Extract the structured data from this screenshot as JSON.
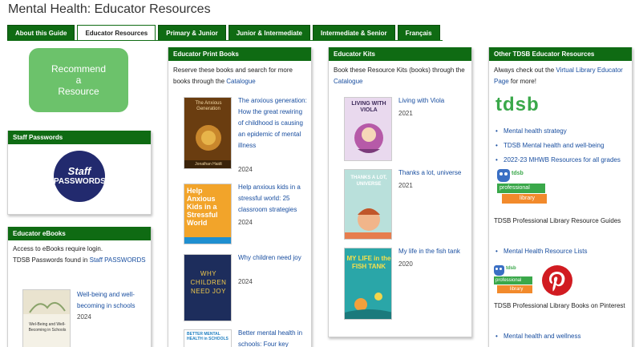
{
  "page_title": "Mental Health: Educator Resources",
  "tabs": [
    {
      "label": "About this Guide"
    },
    {
      "label": "Educator Resources"
    },
    {
      "label": "Primary & Junior"
    },
    {
      "label": "Junior & Intermediate"
    },
    {
      "label": "Intermediate & Senior"
    },
    {
      "label": "Français"
    }
  ],
  "recommend": {
    "line1": "Recommend",
    "line2": "a",
    "line3": "Resource"
  },
  "staff_passwords": {
    "title": "Staff Passwords",
    "logo_line1": "Staff",
    "logo_line2": "PASSWORDS"
  },
  "ebooks": {
    "title": "Educator eBooks",
    "text1": "Access to eBooks require login.",
    "text2": "TDSB Passwords found in",
    "link": "Staff PASSWORDS",
    "book": {
      "title": "Well-being and well-becoming in schools",
      "year": "2024",
      "cover_text": "Wel-Being and Well-Becoming in Schools"
    }
  },
  "print_books": {
    "title": "Educator Print Books",
    "intro": "Reserve these books and search for more books through the",
    "link": "Catalogue",
    "books": [
      {
        "title": "The anxious generation: How the great rewiring of childhood is causing an epidemic of mental illness",
        "year": "2024",
        "cover_title": "The Anxious Generation",
        "cover_author": "Jonathan Haidt"
      },
      {
        "title": "Help anxious kids in a stressful world: 25 classroom strategies",
        "year": "2024",
        "cover_title": "Help Anxious Kids in a Stressful World"
      },
      {
        "title": "Why children need joy",
        "year": "2024",
        "cover_title": "WHY CHILDREN NEED JOY"
      },
      {
        "title": "Better mental health in schools: Four key",
        "year": "",
        "cover_title": "BETTER MENTAL HEALTH in SCHOOLS"
      }
    ]
  },
  "kits": {
    "title": "Educator Kits",
    "intro": "Book these Resource Kits (books) through the",
    "link": "Catalogue",
    "books": [
      {
        "title": "Living with Viola",
        "year": "2021",
        "cover_title": "LIVING WITH VIOLA"
      },
      {
        "title": "Thanks a lot, universe",
        "year": "2021",
        "cover_title": "THANKS A LOT, UNIVERSE"
      },
      {
        "title": "My life in the fish tank",
        "year": "2020",
        "cover_title": "MY LIFE in the FISH TANK"
      }
    ]
  },
  "other": {
    "title": "Other TDSB Educator Resources",
    "intro1": "Always check out the",
    "intro_link": "Virtual Library Educator Page",
    "intro2": "for more!",
    "tdsb_logo": "tdsb",
    "links1": [
      "Mental health strategy",
      "TDSB Mental health and well-being",
      "2022-23 MHWB Resources for all grades"
    ],
    "pl_badge_top": "tdsb",
    "pl_badge_mid": "professional",
    "pl_badge_bot": "library",
    "guides_heading": "TDSB Professional Library Resource Guides",
    "links2": [
      "Mental Health Resource Lists"
    ],
    "pinterest_heading": "TDSB Professional Library Books on Pinterest",
    "links3": [
      "Mental health and wellness"
    ]
  },
  "colors": {
    "tab_green": "#0f6b13",
    "recommend_green": "#6cc26b",
    "link_blue": "#1a4fa0",
    "passwords_navy": "#222a6e",
    "pinterest_red": "#d11b21"
  }
}
